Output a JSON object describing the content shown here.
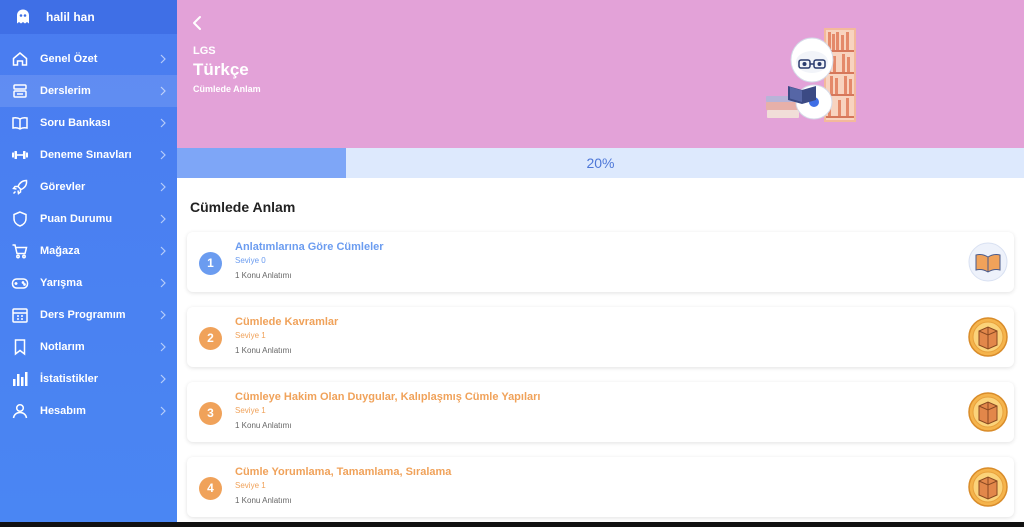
{
  "user": {
    "name": "halil han",
    "avatar_icon": "ghost-icon"
  },
  "sidebar": {
    "items": [
      {
        "label": "Genel Özet",
        "icon": "home-icon"
      },
      {
        "label": "Derslerim",
        "icon": "books-icon"
      },
      {
        "label": "Soru Bankası",
        "icon": "open-book-icon"
      },
      {
        "label": "Deneme Sınavları",
        "icon": "dumbbell-icon"
      },
      {
        "label": "Görevler",
        "icon": "rocket-icon"
      },
      {
        "label": "Puan Durumu",
        "icon": "shield-icon"
      },
      {
        "label": "Mağaza",
        "icon": "cart-icon"
      },
      {
        "label": "Yarışma",
        "icon": "gamepad-icon"
      },
      {
        "label": "Ders Programım",
        "icon": "calendar-icon"
      },
      {
        "label": "Notlarım",
        "icon": "bookmark-icon"
      },
      {
        "label": "İstatistikler",
        "icon": "bar-chart-icon"
      },
      {
        "label": "Hesabım",
        "icon": "user-icon"
      }
    ],
    "active_index": 1
  },
  "header": {
    "exam": "LGS",
    "subject": "Türkçe",
    "topic": "Cümlede Anlam",
    "background": "#e3a2d8"
  },
  "progress": {
    "value": 0.2,
    "label": "20%"
  },
  "section": {
    "title": "Cümlede Anlam"
  },
  "topics": [
    {
      "number": "1",
      "title": "Anlatımlarına Göre Cümleler",
      "level": "Seviye 0",
      "lessons": "1 Konu Anlatımı",
      "color": "#6b9cf0",
      "badge": "open-book-badge-icon"
    },
    {
      "number": "2",
      "title": "Cümlede Kavramlar",
      "level": "Seviye 1",
      "lessons": "1 Konu Anlatımı",
      "color": "#f0a25a",
      "badge": "book-medal-icon"
    },
    {
      "number": "3",
      "title": "Cümleye Hakim Olan Duygular, Kalıplaşmış Cümle Yapıları",
      "level": "Seviye 1",
      "lessons": "1 Konu Anlatımı",
      "color": "#f0a25a",
      "badge": "book-medal-icon"
    },
    {
      "number": "4",
      "title": "Cümle Yorumlama, Tamamlama, Sıralama",
      "level": "Seviye 1",
      "lessons": "1 Konu Anlatımı",
      "color": "#f0a25a",
      "badge": "book-medal-icon"
    }
  ],
  "colors": {
    "accent": "#4a7cf0",
    "level0": "#6b9cf0",
    "level1": "#f0a25a"
  }
}
